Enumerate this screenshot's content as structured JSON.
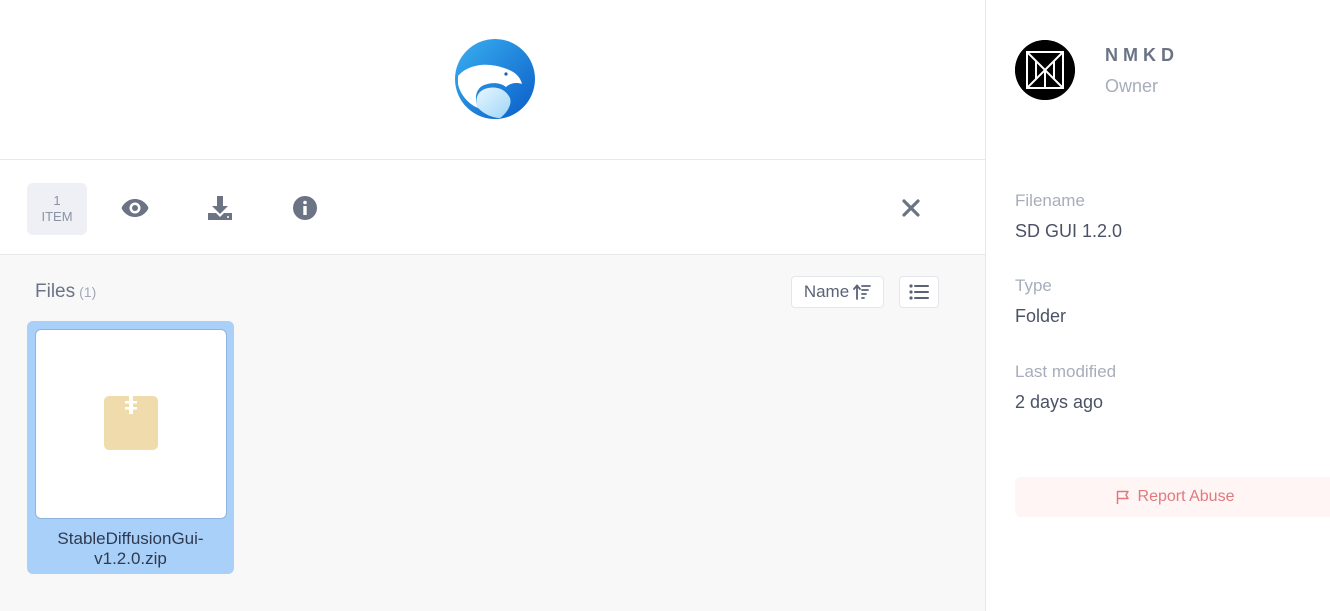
{
  "toolbar": {
    "count_number": "1",
    "count_label": "ITEM",
    "icons": [
      "eye-icon",
      "download-icon",
      "info-icon",
      "close-icon"
    ]
  },
  "files": {
    "title": "Files",
    "count": "(1)",
    "sort_label": "Name",
    "items": [
      {
        "name": "StableDiffusionGui-v1.2.0.zip",
        "icon": "zip-archive-icon"
      }
    ]
  },
  "sidebar": {
    "owner_name": "NMKD",
    "owner_role": "Owner",
    "filename_label": "Filename",
    "filename_value": "SD GUI 1.2.0",
    "type_label": "Type",
    "type_value": "Folder",
    "modified_label": "Last modified",
    "modified_value": "2 days ago",
    "report_label": "Report Abuse"
  },
  "colors": {
    "accent_selected": "#a9d0f8",
    "report_text": "#e0797e",
    "logo_blue": "#1a7fe0"
  }
}
